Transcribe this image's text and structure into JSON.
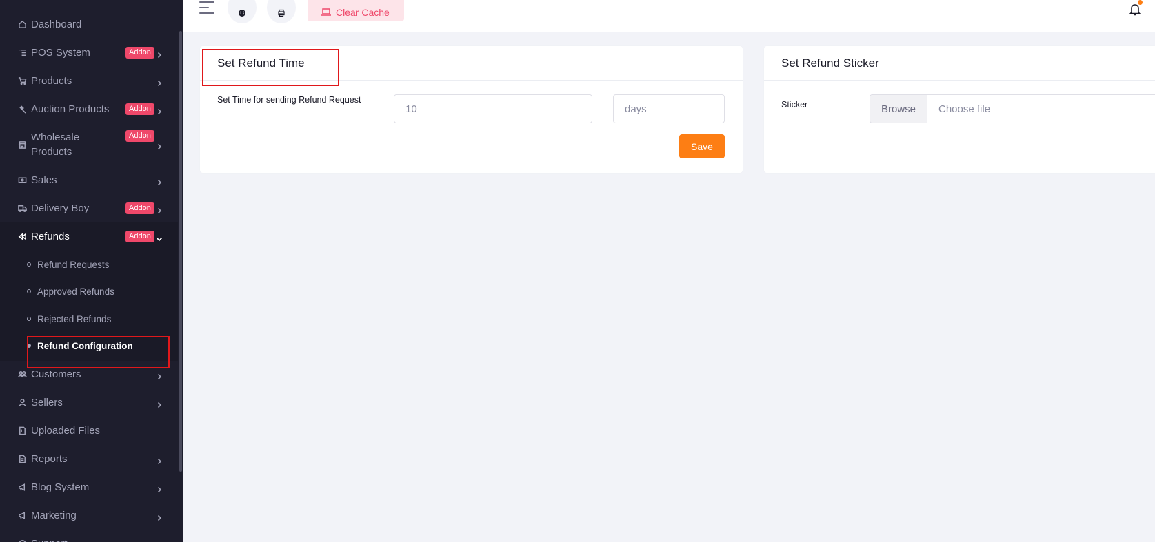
{
  "sidebar": {
    "items": [
      {
        "label": "Dashboard",
        "icon": "home-icon"
      },
      {
        "label": "POS System",
        "icon": "list-icon",
        "badge": "Addon"
      },
      {
        "label": "Products",
        "icon": "cart-icon"
      },
      {
        "label": "Auction Products",
        "icon": "gavel-icon",
        "badge": "Addon"
      },
      {
        "label": "Wholesale",
        "label2": "Products",
        "icon": "store-icon",
        "badge": "Addon"
      },
      {
        "label": "Sales",
        "icon": "money-icon"
      },
      {
        "label": "Delivery Boy",
        "icon": "truck-icon",
        "badge": "Addon"
      },
      {
        "label": "Refunds",
        "icon": "backward-icon",
        "badge": "Addon"
      },
      {
        "label": "Customers",
        "icon": "users-icon"
      },
      {
        "label": "Sellers",
        "icon": "user-icon"
      },
      {
        "label": "Uploaded Files",
        "icon": "folder-icon"
      },
      {
        "label": "Reports",
        "icon": "file-icon"
      },
      {
        "label": "Blog System",
        "icon": "megaphone-icon"
      },
      {
        "label": "Marketing",
        "icon": "megaphone-icon"
      },
      {
        "label": "Support",
        "icon": "support-icon"
      }
    ],
    "refund_sub": [
      {
        "label": "Refund Requests"
      },
      {
        "label": "Approved Refunds"
      },
      {
        "label": "Rejected Refunds"
      },
      {
        "label": "Refund Configuration"
      }
    ]
  },
  "topbar": {
    "clear_cache_label": "Clear Cache"
  },
  "refund_time": {
    "title": "Set Refund Time",
    "field_label": "Set Time for sending Refund Request",
    "value": "10",
    "unit": "days",
    "save_label": "Save"
  },
  "refund_sticker": {
    "title": "Set Refund Sticker",
    "field_label": "Sticker",
    "browse_label": "Browse",
    "file_placeholder": "Choose file"
  },
  "colors": {
    "sidebar_bg": "#1e1e2d",
    "addon_badge": "#ef486a",
    "save_button": "#fd7e14",
    "highlight": "#e0181b"
  }
}
